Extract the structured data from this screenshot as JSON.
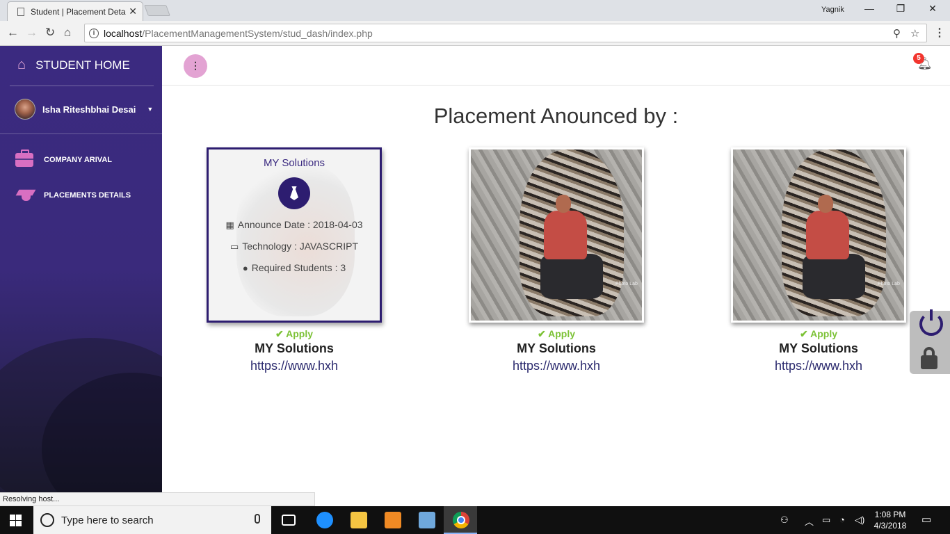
{
  "browser": {
    "tab_title": "Student | Placement Deta",
    "tab_close": "✕",
    "window_user": "Yagnik",
    "minimize": "—",
    "restore": "❐",
    "close": "✕",
    "url_host": "localhost",
    "url_path": "/PlacementManagementSystem/stud_dash/index.php",
    "status_text": "Resolving host..."
  },
  "sidebar": {
    "brand": "STUDENT HOME",
    "user_name": "Isha Riteshbhai Desai",
    "items": [
      {
        "label": "COMPANY ARIVAL",
        "icon": "briefcase-icon"
      },
      {
        "label": "PLACEMENTS DETAILS",
        "icon": "graduation-cap-icon"
      }
    ]
  },
  "topbar": {
    "menu_icon": "⋮",
    "notification_count": "5"
  },
  "main": {
    "title": "Placement Anounced by :",
    "cards": [
      {
        "company": "MY Solutions",
        "announce_date": "Announce Date : 2018-04-03",
        "technology": "Technology : JAVASCRIPT",
        "required": "Required Students : 3",
        "apply": "Apply",
        "name": "MY Solutions",
        "url": "https://www.hxh"
      },
      {
        "apply": "Apply",
        "name": "MY Solutions",
        "url": "https://www.hxh"
      },
      {
        "apply": "Apply",
        "name": "MY Solutions",
        "url": "https://www.hxh"
      }
    ],
    "photo_watermark": "Photo Lab"
  },
  "taskbar": {
    "search_placeholder": "Type here to search",
    "time": "1:08 PM",
    "date": "4/3/2018"
  },
  "colors": {
    "sidebar": "#3b2a80",
    "accent": "#2d1d70",
    "apply": "#7cc236",
    "pink": "#d86fc2"
  }
}
